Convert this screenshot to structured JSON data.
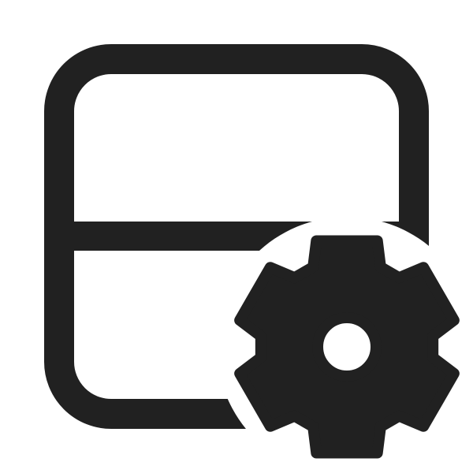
{
  "icon": {
    "name": "table-settings-icon",
    "parts": [
      "split-panel-frame-icon",
      "gear-icon"
    ],
    "colors": {
      "foreground": "#212121",
      "background": "#ffffff"
    }
  }
}
